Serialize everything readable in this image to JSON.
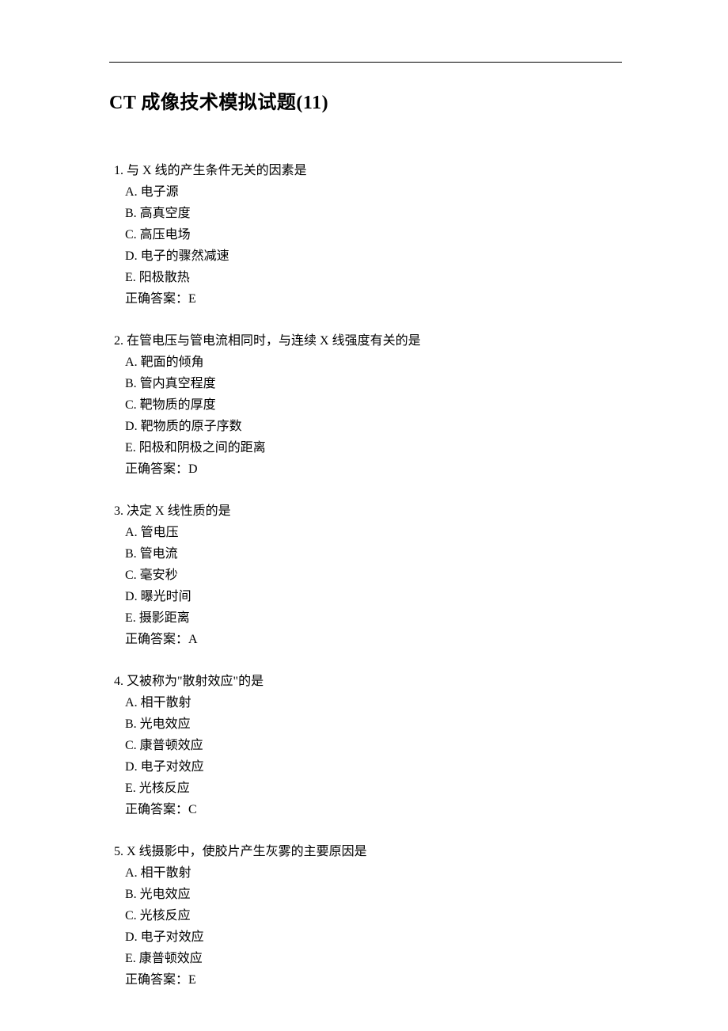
{
  "title_prefix": "CT ",
  "title_main": "成像技术模拟试题",
  "title_suffix": "(11)",
  "answer_label": "正确答案：",
  "option_letters": [
    "A",
    "B",
    "C",
    "D",
    "E"
  ],
  "questions": [
    {
      "num": "1. ",
      "stem_before": "与 ",
      "stem_latin": "X ",
      "stem_after": "线的产生条件无关的因素是",
      "options": [
        "电子源",
        "高真空度",
        "高压电场",
        "电子的骤然减速",
        "阳极散热"
      ],
      "answer": "E"
    },
    {
      "num": "2. ",
      "stem_before": "在管电压与管电流相同时，与连续 ",
      "stem_latin": "X ",
      "stem_after": "线强度有关的是",
      "options": [
        "靶面的倾角",
        "管内真空程度",
        "靶物质的厚度",
        "靶物质的原子序数",
        "阳极和阴极之间的距离"
      ],
      "answer": "D"
    },
    {
      "num": "3. ",
      "stem_before": "决定 ",
      "stem_latin": "X ",
      "stem_after": "线性质的是",
      "options": [
        "管电压",
        "管电流",
        "毫安秒",
        "曝光时间",
        "摄影距离"
      ],
      "answer": "A"
    },
    {
      "num": "4. ",
      "stem_before": "又被称为\"散射效应\"的是",
      "stem_latin": "",
      "stem_after": "",
      "options": [
        "相干散射",
        "光电效应",
        "康普顿效应",
        "电子对效应",
        "光核反应"
      ],
      "answer": "C"
    },
    {
      "num": "5. ",
      "stem_before": "",
      "stem_latin": "X ",
      "stem_after": "线摄影中，使胶片产生灰雾的主要原因是",
      "options": [
        "相干散射",
        "光电效应",
        "光核反应",
        "电子对效应",
        "康普顿效应"
      ],
      "answer": "E"
    }
  ]
}
